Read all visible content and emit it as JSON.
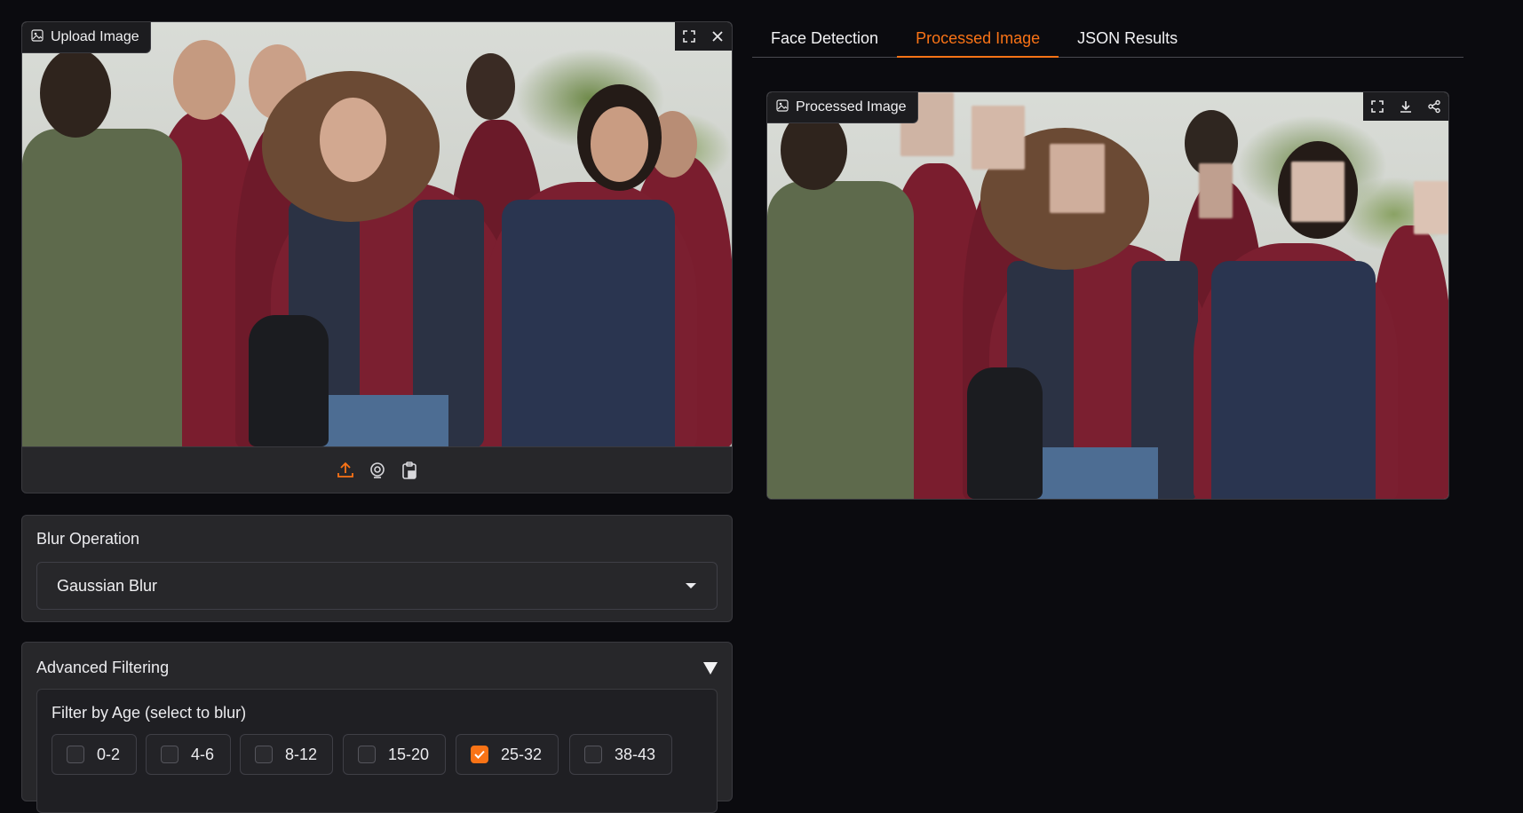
{
  "upload": {
    "label": "Upload Image",
    "icons": {
      "image": "image-icon",
      "fullscreen": "fullscreen-icon",
      "close": "close-icon",
      "upload": "upload-icon",
      "webcam": "webcam-icon",
      "clipboard": "clipboard-icon"
    }
  },
  "tabs": [
    {
      "label": "Face Detection",
      "active": false
    },
    {
      "label": "Processed Image",
      "active": true
    },
    {
      "label": "JSON Results",
      "active": false
    }
  ],
  "processed": {
    "label": "Processed Image",
    "icons": {
      "image": "image-icon",
      "fullscreen": "fullscreen-icon",
      "download": "download-icon",
      "share": "share-icon"
    }
  },
  "blur": {
    "title": "Blur Operation",
    "selected": "Gaussian Blur"
  },
  "advanced": {
    "title": "Advanced Filtering",
    "age_filter_title": "Filter by Age (select to blur)",
    "age_options": [
      {
        "label": "0-2",
        "checked": false
      },
      {
        "label": "4-6",
        "checked": false
      },
      {
        "label": "8-12",
        "checked": false
      },
      {
        "label": "15-20",
        "checked": false
      },
      {
        "label": "25-32",
        "checked": true
      },
      {
        "label": "38-43",
        "checked": false
      }
    ]
  },
  "colors": {
    "accent": "#f97316",
    "background": "#0b0b0f",
    "panel": "#27272a"
  }
}
